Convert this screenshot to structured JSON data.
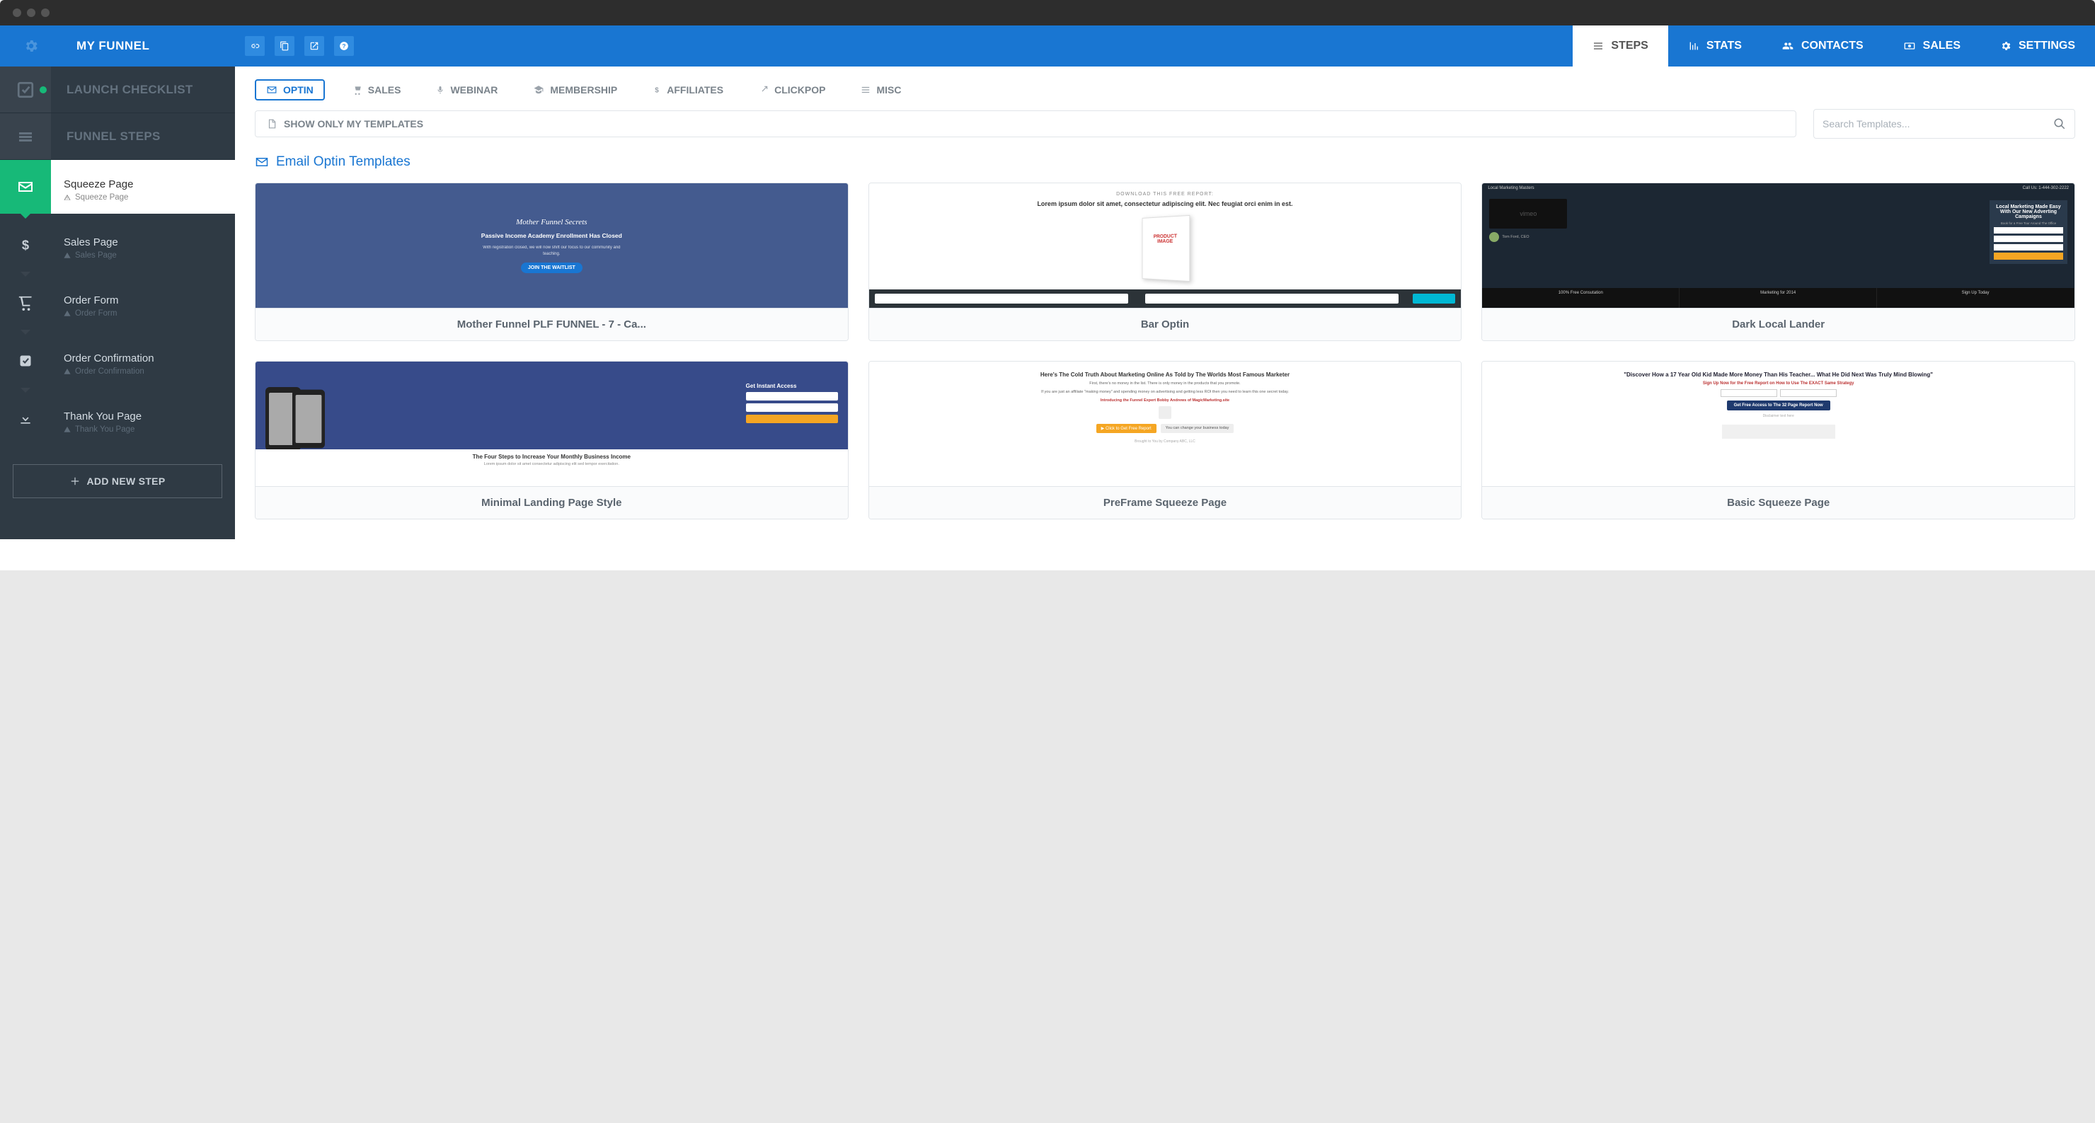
{
  "header": {
    "title": "MY FUNNEL",
    "tabs": [
      {
        "label": "STEPS",
        "active": true
      },
      {
        "label": "STATS"
      },
      {
        "label": "CONTACTS"
      },
      {
        "label": "SALES"
      },
      {
        "label": "SETTINGS"
      }
    ]
  },
  "sidebar": {
    "launch_checklist": "LAUNCH CHECKLIST",
    "funnel_steps": "FUNNEL STEPS",
    "steps": [
      {
        "title": "Squeeze Page",
        "sub": "Squeeze Page",
        "icon": "mail",
        "active": true
      },
      {
        "title": "Sales Page",
        "sub": "Sales Page",
        "icon": "dollar"
      },
      {
        "title": "Order Form",
        "sub": "Order Form",
        "icon": "cart"
      },
      {
        "title": "Order Confirmation",
        "sub": "Order Confirmation",
        "icon": "check"
      },
      {
        "title": "Thank You Page",
        "sub": "Thank You Page",
        "icon": "download"
      }
    ],
    "add_step": "ADD NEW STEP"
  },
  "pills": [
    {
      "label": "OPTIN",
      "active": true
    },
    {
      "label": "SALES"
    },
    {
      "label": "WEBINAR"
    },
    {
      "label": "MEMBERSHIP"
    },
    {
      "label": "AFFILIATES"
    },
    {
      "label": "CLICKPOP"
    },
    {
      "label": "MISC"
    }
  ],
  "filter": {
    "show_only": "SHOW ONLY MY TEMPLATES",
    "search_placeholder": "Search Templates..."
  },
  "section_title": "Email Optin Templates",
  "templates": [
    {
      "caption": "Mother Funnel PLF FUNNEL - 7 - Ca..."
    },
    {
      "caption": "Bar Optin"
    },
    {
      "caption": "Dark Local Lander"
    },
    {
      "caption": "Minimal Landing Page Style"
    },
    {
      "caption": "PreFrame Squeeze Page"
    },
    {
      "caption": "Basic Squeeze Page"
    }
  ]
}
